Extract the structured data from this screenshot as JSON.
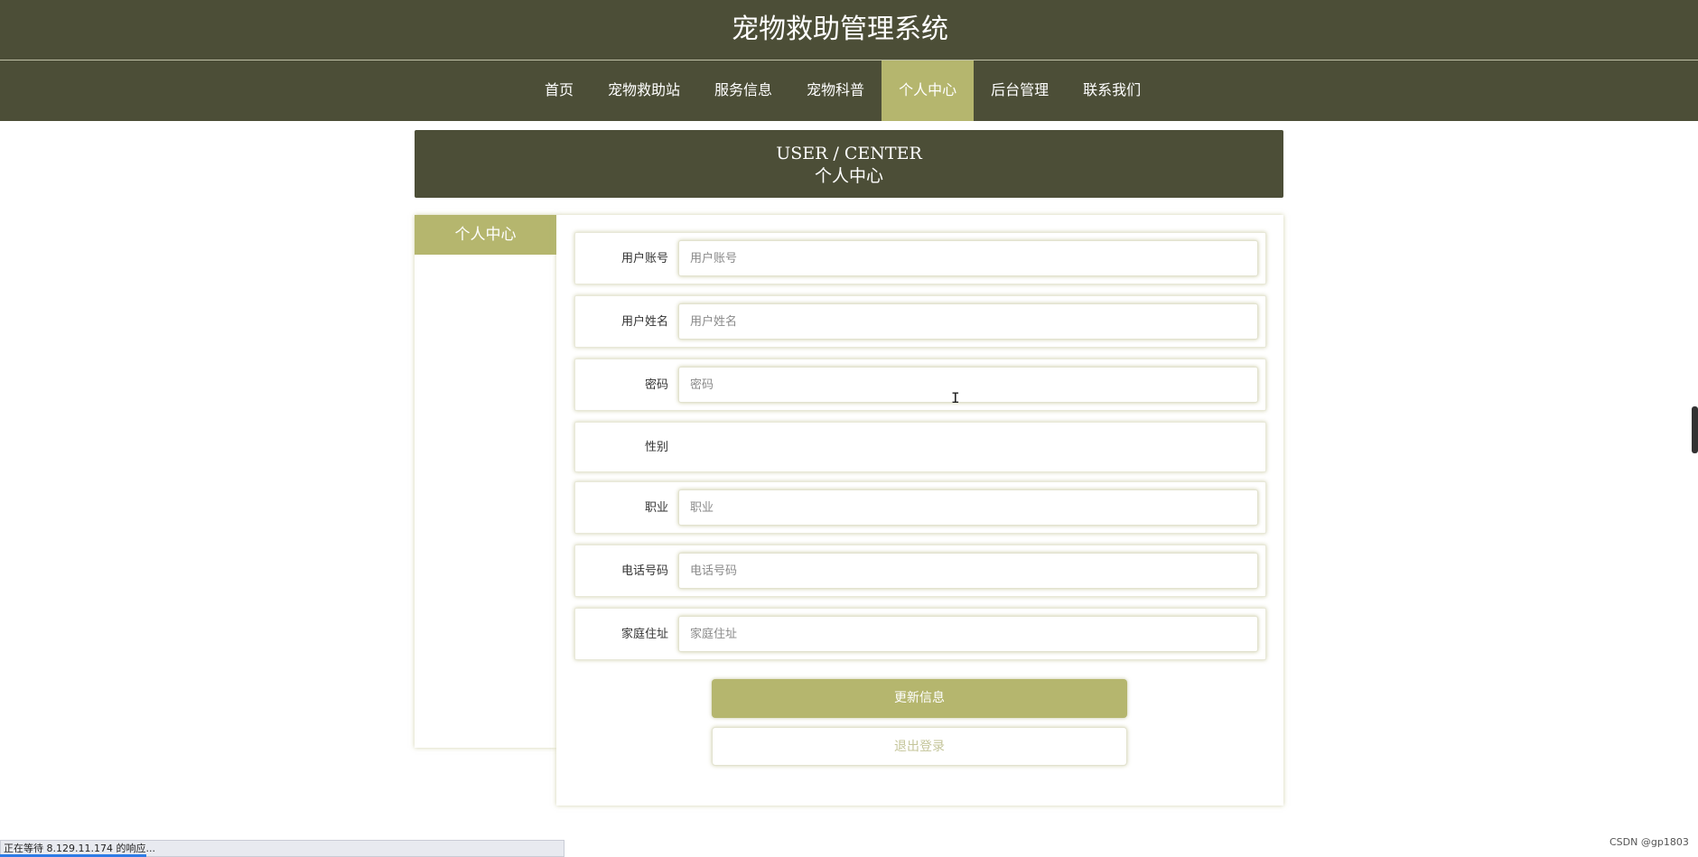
{
  "header": {
    "site_title": "宠物救助管理系统",
    "nav": [
      {
        "label": "首页",
        "active": false
      },
      {
        "label": "宠物救助站",
        "active": false
      },
      {
        "label": "服务信息",
        "active": false
      },
      {
        "label": "宠物科普",
        "active": false
      },
      {
        "label": "个人中心",
        "active": true
      },
      {
        "label": "后台管理",
        "active": false
      },
      {
        "label": "联系我们",
        "active": false
      }
    ]
  },
  "banner": {
    "en": "USER / CENTER",
    "cn": "个人中心"
  },
  "sidebar": {
    "title": "个人中心"
  },
  "form": {
    "fields": [
      {
        "label": "用户账号",
        "placeholder": "用户账号",
        "value": ""
      },
      {
        "label": "用户姓名",
        "placeholder": "用户姓名",
        "value": ""
      },
      {
        "label": "密码",
        "placeholder": "密码",
        "value": ""
      },
      {
        "label": "性别"
      },
      {
        "label": "职业",
        "placeholder": "职业",
        "value": ""
      },
      {
        "label": "电话号码",
        "placeholder": "电话号码",
        "value": ""
      },
      {
        "label": "家庭住址",
        "placeholder": "家庭住址",
        "value": ""
      }
    ],
    "update_label": "更新信息",
    "logout_label": "退出登录"
  },
  "browser": {
    "status_text": "正在等待 8.129.11.174 的响应...",
    "watermark": "CSDN @gp1803"
  },
  "colors": {
    "header_bg": "#4c4e37",
    "accent": "#b5b66e"
  }
}
